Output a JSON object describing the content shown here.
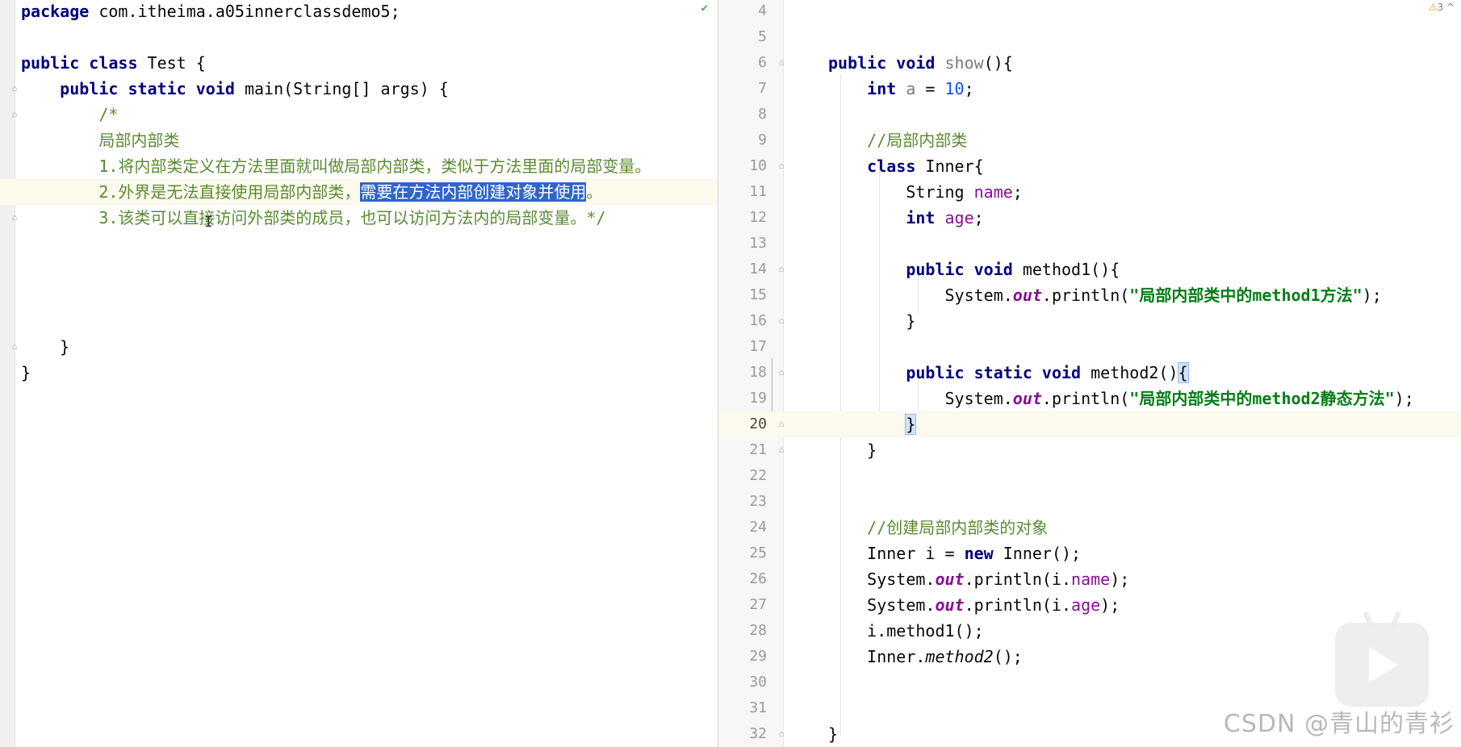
{
  "left_editor": {
    "lines": [
      {
        "segments": [
          {
            "t": "package",
            "c": "kw2"
          },
          {
            "t": " com.itheima.a05innerclassdemo5;",
            "c": ""
          }
        ]
      },
      {
        "segments": []
      },
      {
        "segments": [
          {
            "t": "public",
            "c": "kw2"
          },
          {
            "t": " ",
            "c": ""
          },
          {
            "t": "class",
            "c": "kw2"
          },
          {
            "t": " Test {",
            "c": ""
          }
        ]
      },
      {
        "segments": [
          {
            "t": "    ",
            "c": ""
          },
          {
            "t": "public",
            "c": "kw2"
          },
          {
            "t": " ",
            "c": ""
          },
          {
            "t": "static",
            "c": "kw2"
          },
          {
            "t": " ",
            "c": ""
          },
          {
            "t": "void",
            "c": "kw2"
          },
          {
            "t": " main(String[] args) {",
            "c": ""
          }
        ]
      },
      {
        "segments": [
          {
            "t": "        ",
            "c": ""
          },
          {
            "t": "/*",
            "c": "cmtm"
          }
        ]
      },
      {
        "segments": [
          {
            "t": "        ",
            "c": ""
          },
          {
            "t": "局部内部类",
            "c": "cmt"
          }
        ]
      },
      {
        "segments": [
          {
            "t": "        ",
            "c": ""
          },
          {
            "t": "1.",
            "c": "cmtm"
          },
          {
            "t": "将内部类定义在方法里面就叫做局部内部类，类似于方法里面的局部变量。",
            "c": "cmt"
          }
        ]
      },
      {
        "segments": [
          {
            "t": "        ",
            "c": ""
          },
          {
            "t": "2.",
            "c": "cmtm"
          },
          {
            "t": "外界是无法直接使用局部内部类，",
            "c": "cmt"
          },
          {
            "t": "需要在方法内部创建对象并使用",
            "c": "cmt sel"
          },
          {
            "t": "。",
            "c": "cmt"
          }
        ],
        "hl": true
      },
      {
        "segments": [
          {
            "t": "        ",
            "c": ""
          },
          {
            "t": "3.",
            "c": "cmtm"
          },
          {
            "t": "该类可以直接访问外部类的成员，也可以访问方法内的局部变量。",
            "c": "cmt"
          },
          {
            "t": "*/",
            "c": "cmtm"
          }
        ]
      },
      {
        "segments": []
      },
      {
        "segments": []
      },
      {
        "segments": []
      },
      {
        "segments": []
      },
      {
        "segments": [
          {
            "t": "    }",
            "c": ""
          }
        ]
      },
      {
        "segments": [
          {
            "t": "}",
            "c": ""
          }
        ]
      }
    ]
  },
  "right_editor": {
    "lines": [
      {
        "n": "4",
        "segments": []
      },
      {
        "n": "5",
        "segments": []
      },
      {
        "n": "6",
        "segments": [
          {
            "t": "public",
            "c": "kw2"
          },
          {
            "t": " ",
            "c": ""
          },
          {
            "t": "void",
            "c": "kw2"
          },
          {
            "t": " ",
            "c": ""
          },
          {
            "t": "show",
            "c": "unused"
          },
          {
            "t": "(){",
            "c": ""
          }
        ]
      },
      {
        "n": "7",
        "segments": [
          {
            "t": "    ",
            "c": ""
          },
          {
            "t": "int",
            "c": "kw2"
          },
          {
            "t": " ",
            "c": ""
          },
          {
            "t": "a",
            "c": "unused"
          },
          {
            "t": " = ",
            "c": ""
          },
          {
            "t": "10",
            "c": "num"
          },
          {
            "t": ";",
            "c": ""
          }
        ]
      },
      {
        "n": "8",
        "segments": []
      },
      {
        "n": "9",
        "segments": [
          {
            "t": "    ",
            "c": ""
          },
          {
            "t": "//",
            "c": "cmtm"
          },
          {
            "t": "局部内部类",
            "c": "cmt"
          }
        ]
      },
      {
        "n": "10",
        "segments": [
          {
            "t": "    ",
            "c": ""
          },
          {
            "t": "class",
            "c": "kw2"
          },
          {
            "t": " Inner{",
            "c": ""
          }
        ]
      },
      {
        "n": "11",
        "segments": [
          {
            "t": "        String ",
            "c": ""
          },
          {
            "t": "name",
            "c": "fld"
          },
          {
            "t": ";",
            "c": ""
          }
        ]
      },
      {
        "n": "12",
        "segments": [
          {
            "t": "        ",
            "c": ""
          },
          {
            "t": "int",
            "c": "kw2"
          },
          {
            "t": " ",
            "c": ""
          },
          {
            "t": "age",
            "c": "fld"
          },
          {
            "t": ";",
            "c": ""
          }
        ]
      },
      {
        "n": "13",
        "segments": []
      },
      {
        "n": "14",
        "segments": [
          {
            "t": "        ",
            "c": ""
          },
          {
            "t": "public",
            "c": "kw2"
          },
          {
            "t": " ",
            "c": ""
          },
          {
            "t": "void",
            "c": "kw2"
          },
          {
            "t": " method1(){",
            "c": ""
          }
        ]
      },
      {
        "n": "15",
        "segments": [
          {
            "t": "            System.",
            "c": ""
          },
          {
            "t": "out",
            "c": "static"
          },
          {
            "t": ".println(",
            "c": ""
          },
          {
            "t": "\"局部内部类中的method1方法\"",
            "c": "str"
          },
          {
            "t": ");",
            "c": ""
          }
        ]
      },
      {
        "n": "16",
        "segments": [
          {
            "t": "        }",
            "c": ""
          }
        ]
      },
      {
        "n": "17",
        "segments": []
      },
      {
        "n": "18",
        "segments": [
          {
            "t": "        ",
            "c": ""
          },
          {
            "t": "public",
            "c": "kw2"
          },
          {
            "t": " ",
            "c": ""
          },
          {
            "t": "static",
            "c": "kw2"
          },
          {
            "t": " ",
            "c": ""
          },
          {
            "t": "void",
            "c": "kw2"
          },
          {
            "t": " method2()",
            "c": ""
          },
          {
            "t": "{",
            "c": "brace-hl"
          }
        ]
      },
      {
        "n": "19",
        "segments": [
          {
            "t": "            System.",
            "c": ""
          },
          {
            "t": "out",
            "c": "static"
          },
          {
            "t": ".println(",
            "c": ""
          },
          {
            "t": "\"局部内部类中的method2静态方法\"",
            "c": "str"
          },
          {
            "t": ");",
            "c": ""
          }
        ]
      },
      {
        "n": "20",
        "segments": [
          {
            "t": "        ",
            "c": ""
          },
          {
            "t": "}",
            "c": "brace-hl"
          }
        ],
        "hl": true
      },
      {
        "n": "21",
        "segments": [
          {
            "t": "    }",
            "c": ""
          }
        ]
      },
      {
        "n": "22",
        "segments": []
      },
      {
        "n": "23",
        "segments": []
      },
      {
        "n": "24",
        "segments": [
          {
            "t": "    ",
            "c": ""
          },
          {
            "t": "//",
            "c": "cmtm"
          },
          {
            "t": "创建局部内部类的对象",
            "c": "cmt"
          }
        ]
      },
      {
        "n": "25",
        "segments": [
          {
            "t": "    Inner i = ",
            "c": ""
          },
          {
            "t": "new",
            "c": "kw2"
          },
          {
            "t": " Inner();",
            "c": ""
          }
        ]
      },
      {
        "n": "26",
        "segments": [
          {
            "t": "    System.",
            "c": ""
          },
          {
            "t": "out",
            "c": "static"
          },
          {
            "t": ".println(i.",
            "c": ""
          },
          {
            "t": "name",
            "c": "fld"
          },
          {
            "t": ");",
            "c": ""
          }
        ]
      },
      {
        "n": "27",
        "segments": [
          {
            "t": "    System.",
            "c": ""
          },
          {
            "t": "out",
            "c": "static"
          },
          {
            "t": ".println(i.",
            "c": ""
          },
          {
            "t": "age",
            "c": "fld"
          },
          {
            "t": ");",
            "c": ""
          }
        ]
      },
      {
        "n": "28",
        "segments": [
          {
            "t": "    i.method1();",
            "c": ""
          }
        ]
      },
      {
        "n": "29",
        "segments": [
          {
            "t": "    Inner.",
            "c": ""
          },
          {
            "t": "method2",
            "c": "stat-m"
          },
          {
            "t": "();",
            "c": ""
          }
        ]
      },
      {
        "n": "30",
        "segments": []
      },
      {
        "n": "31",
        "segments": []
      },
      {
        "n": "32",
        "segments": [
          {
            "t": "}",
            "c": ""
          }
        ]
      }
    ],
    "warning_count": "3"
  },
  "watermark": "CSDN @青山的青衫",
  "icons": {
    "check": "check-icon",
    "warning": "warning-icon",
    "play": "play-icon",
    "cursor": "text-cursor-icon",
    "fold": "fold-marker-icon"
  },
  "colors": {
    "keyword": "#000080",
    "comment": "#5a8b32",
    "string": "#067d17",
    "field": "#871094",
    "number": "#1750eb",
    "selection": "#2f65ca",
    "current_line": "#fcfaed"
  }
}
